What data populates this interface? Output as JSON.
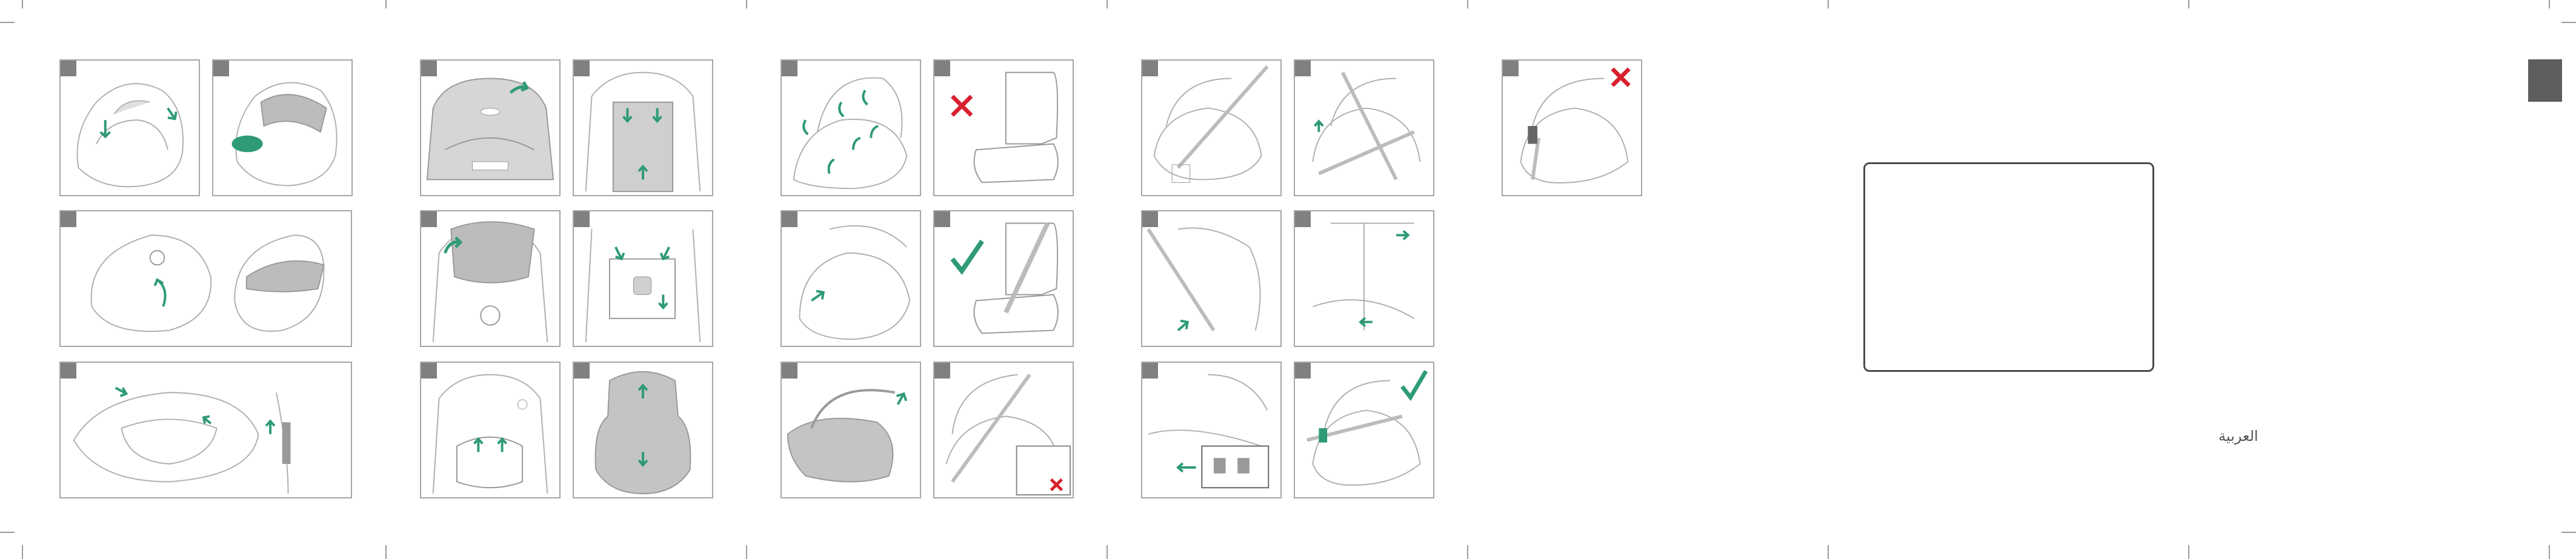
{
  "page": {
    "language_label": "العربية"
  },
  "colors": {
    "arrow": "#2e9a78",
    "cross": "#d8202f",
    "check": "#2e9a78",
    "frame": "#a6a6a6",
    "highlight": "#bcbcbc"
  },
  "panels": [
    {
      "id": "p01",
      "icon": "seat-cover-arrows"
    },
    {
      "id": "p02",
      "icon": "seat-canopy-pad"
    },
    {
      "id": "p03",
      "icon": "canopy-unfold"
    },
    {
      "id": "p04",
      "icon": "seat-buckle-arrows"
    },
    {
      "id": "p05",
      "icon": "seat-shell-arrow"
    },
    {
      "id": "p06",
      "icon": "headrest-harness"
    },
    {
      "id": "p07",
      "icon": "headrest-remove"
    },
    {
      "id": "p08",
      "icon": "harness-buckle"
    },
    {
      "id": "p09",
      "icon": "harness-pads"
    },
    {
      "id": "p10",
      "icon": "inlay-cushion"
    },
    {
      "id": "p11",
      "icon": "carrier-handle-arrows"
    },
    {
      "id": "p12",
      "icon": "car-seat-wrong",
      "mark": "cross"
    },
    {
      "id": "p13",
      "icon": "carrier-base-arrows"
    },
    {
      "id": "p14",
      "icon": "car-seat-belt-ok",
      "mark": "check"
    },
    {
      "id": "p15",
      "icon": "carrier-handle-up"
    },
    {
      "id": "p16",
      "icon": "belt-routing-wrong",
      "mark": "cross"
    },
    {
      "id": "p17",
      "icon": "car-install-belt"
    },
    {
      "id": "p18",
      "icon": "car-install-belt-2"
    },
    {
      "id": "p19",
      "icon": "shoulder-belt"
    },
    {
      "id": "p20",
      "icon": "belt-tension"
    },
    {
      "id": "p21",
      "icon": "belt-clip-detail"
    },
    {
      "id": "p22",
      "icon": "installed-ok",
      "mark": "check"
    },
    {
      "id": "p23",
      "icon": "installed-wrong",
      "mark": "cross"
    }
  ]
}
